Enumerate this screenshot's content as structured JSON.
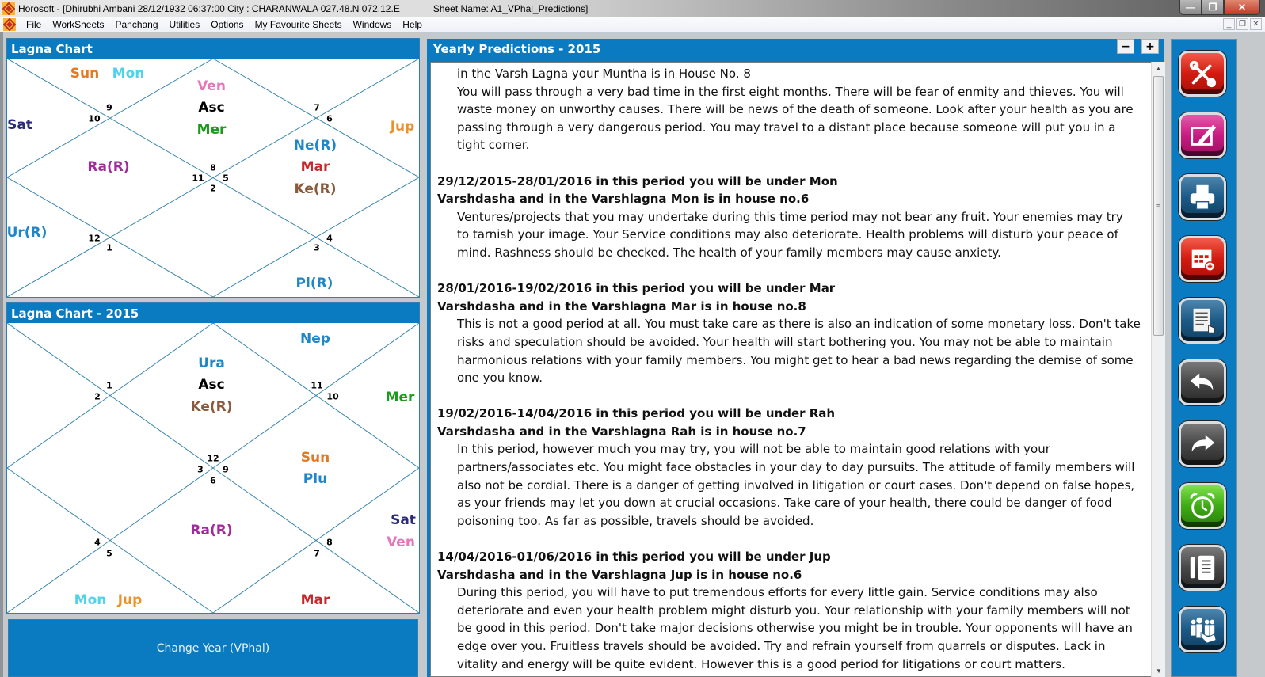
{
  "window": {
    "app_name": "Horosoft",
    "title": "Horosoft - [Dhirubhi Ambani 28/12/1932 06:37:00  City : CHARANWALA 027.48.N 072.12.E",
    "sheet": "Sheet Name: A1_VPhal_Predictions]",
    "controls": {
      "minimize": "—",
      "maximize": "❐",
      "close": "✕"
    }
  },
  "menubar": {
    "items": [
      "File",
      "WorkSheets",
      "Panchang",
      "Utilities",
      "Options",
      "My Favourite Sheets",
      "Windows",
      "Help"
    ],
    "mdi_controls": {
      "minimize": "_",
      "restore": "❐",
      "close": "✕"
    }
  },
  "lagna_chart": {
    "title": "Lagna Chart",
    "house_numbers": {
      "top_left": [
        "9",
        "10"
      ],
      "top_right": [
        "7",
        "6"
      ],
      "center": [
        "8",
        "11",
        "5",
        "2"
      ],
      "bottom_left": [
        "12",
        "1"
      ],
      "bottom_right": [
        "4",
        "3"
      ]
    },
    "planets": {
      "top_left_triangle": [
        {
          "name": "Sun",
          "color": "#e07a26"
        },
        {
          "name": "Mon",
          "color": "#4fd3ea"
        }
      ],
      "top_center": [
        {
          "name": "Ven",
          "color": "#e676b8"
        },
        {
          "name": "Asc",
          "color": "#000000"
        },
        {
          "name": "Mer",
          "color": "#1d9a1d"
        }
      ],
      "left_triangle": [
        {
          "name": "Sat",
          "color": "#2c2a7a"
        }
      ],
      "right_triangle": [
        {
          "name": "Jup",
          "color": "#e8922a"
        }
      ],
      "left_diamond": [
        {
          "name": "Ra(R)",
          "color": "#a02c9c"
        }
      ],
      "right_diamond": [
        {
          "name": "Ne(R)",
          "color": "#1f86c8"
        },
        {
          "name": "Mar",
          "color": "#c6292c"
        },
        {
          "name": "Ke(R)",
          "color": "#8a5a3c"
        }
      ],
      "bottom_left_triangle": [
        {
          "name": "Ur(R)",
          "color": "#1f86c8"
        }
      ],
      "bottom_right_triangle": [
        {
          "name": "Pl(R)",
          "color": "#1f86c8"
        }
      ]
    }
  },
  "lagna_chart_2015": {
    "title": "Lagna Chart - 2015",
    "house_numbers": {
      "top_left": [
        "1",
        "2"
      ],
      "top_right": [
        "11",
        "10"
      ],
      "center": [
        "12",
        "3",
        "9",
        "6"
      ],
      "bottom_left": [
        "4",
        "5"
      ],
      "bottom_right": [
        "8",
        "7"
      ]
    },
    "planets": {
      "top_right_triangle": [
        {
          "name": "Nep",
          "color": "#1f86c8"
        }
      ],
      "top_center": [
        {
          "name": "Ura",
          "color": "#1f86c8"
        },
        {
          "name": "Asc",
          "color": "#000000"
        },
        {
          "name": "Ke(R)",
          "color": "#8a5a3c"
        }
      ],
      "right_triangle": [
        {
          "name": "Mer",
          "color": "#1d9a1d"
        }
      ],
      "right_diamond": [
        {
          "name": "Sun",
          "color": "#e07a26"
        },
        {
          "name": "Plu",
          "color": "#1f86c8"
        }
      ],
      "bottom_center": [
        {
          "name": "Ra(R)",
          "color": "#a02c9c"
        }
      ],
      "right_lower_triangle": [
        {
          "name": "Sat",
          "color": "#2c2a7a"
        },
        {
          "name": "Ven",
          "color": "#e676b8"
        }
      ],
      "bottom_left_triangle": [
        {
          "name": "Mon",
          "color": "#4fd3ea"
        },
        {
          "name": "Jup",
          "color": "#e8922a"
        }
      ],
      "bottom_right_triangle": [
        {
          "name": "Mar",
          "color": "#c6292c"
        }
      ]
    }
  },
  "change_year_button": "Change Year (VPhal)",
  "predictions": {
    "title": "Yearly Predictions - 2015",
    "zoom_out": "−",
    "zoom_in": "+",
    "intro": [
      "in the Varsh Lagna your Muntha is in House No. 8",
      "You will pass through a very bad time in the first eight months. There will be fear of enmity and thieves. You will",
      "waste money on unworthy causes. There will be news of the death of someone. Look after your health as you are",
      "passing through a very dangerous period. You may travel to a distant place because someone will put you in a",
      "tight corner."
    ],
    "periods": [
      {
        "heading": [
          "29/12/2015-28/01/2016 in this period you will be under Mon",
          "Varshdasha and in the Varshlagna Mon is in house no.6"
        ],
        "lines": [
          "Ventures/projects that you may undertake during this time period may not bear any fruit. Your enemies may try",
          "to tarnish your image. Your Service conditions may also deteriorate. Health problems will disturb your peace of",
          "mind. Rashness should be checked. The health of your family members may cause anxiety."
        ]
      },
      {
        "heading": [
          "28/01/2016-19/02/2016 in this period you will be under Mar",
          "Varshdasha and in the Varshlagna Mar is in house no.8"
        ],
        "lines": [
          "This is not a good period at all. You must take care as there is also an indication of some monetary loss. Don't take",
          "risks and speculation should be avoided. Your health will start bothering you. You may not be able to maintain",
          "harmonious relations with your family members. You might get to hear a bad news regarding the demise of some",
          "one you know."
        ]
      },
      {
        "heading": [
          "19/02/2016-14/04/2016 in this period you will be under Rah",
          "Varshdasha and in the Varshlagna Rah is in house no.7"
        ],
        "lines": [
          "In this period, however much you may try, you will not be able to maintain good relations with your",
          "partners/associates etc. You might face obstacles in your day to day pursuits. The attitude of family members will",
          "also not be cordial. There is a danger of getting involved in litigation or court cases. Don't depend on false hopes,",
          "as your friends may let you down at crucial occasions. Take care of your health, there could be danger of food",
          "poisoning too. As far as possible, travels should be avoided."
        ]
      },
      {
        "heading": [
          "14/04/2016-01/06/2016 in this period you will be under Jup",
          "Varshdasha and in the Varshlagna Jup is in house no.6"
        ],
        "lines": [
          "During this period, you will have to put tremendous efforts for every little gain. Service conditions may also",
          "deteriorate and even your health problem might disturb you. Your relationship with your family members will not",
          "be good in this period. Don't take major decisions otherwise you might be in trouble. Your opponents will have an",
          "edge over you. Fruitless travels should be avoided. Try and refrain yourself from quarrels or disputes. Lack in",
          "vitality and energy will be quite evident. However this is a good period for litigations or court matters."
        ]
      }
    ]
  },
  "toolbar": {
    "buttons": [
      {
        "name": "tools",
        "icon": "wrench-screwdriver-icon",
        "color": "red"
      },
      {
        "name": "edit",
        "icon": "edit-pencil-icon",
        "color": "magenta"
      },
      {
        "name": "print",
        "icon": "printer-icon",
        "color": "blue"
      },
      {
        "name": "calendar",
        "icon": "calendar-add-icon",
        "color": "red"
      },
      {
        "name": "document",
        "icon": "document-hand-icon",
        "color": "blue"
      },
      {
        "name": "back",
        "icon": "back-arrow-icon",
        "color": "gray"
      },
      {
        "name": "forward",
        "icon": "forward-arrow-icon",
        "color": "gray"
      },
      {
        "name": "alarm",
        "icon": "alarm-clock-icon",
        "color": "green"
      },
      {
        "name": "notebook",
        "icon": "notebook-icon",
        "color": "gray"
      },
      {
        "name": "group",
        "icon": "group-hand-icon",
        "color": "blue"
      }
    ]
  }
}
